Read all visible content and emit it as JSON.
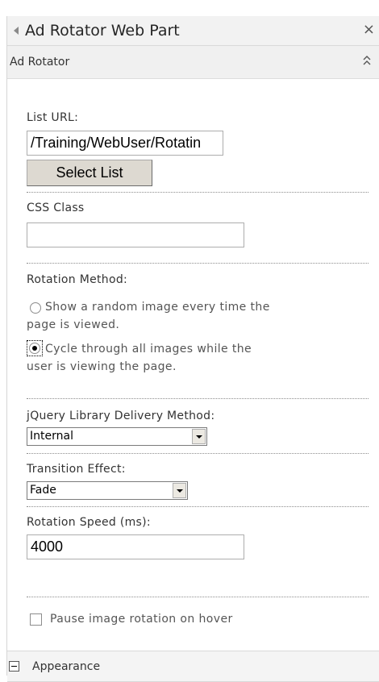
{
  "panel": {
    "title": "Ad Rotator Web Part",
    "close_glyph": "×"
  },
  "section": {
    "title": "Ad Rotator"
  },
  "fields": {
    "list_url": {
      "label": "List URL:",
      "value": "/Training/WebUser/Rotatin",
      "button": "Select List"
    },
    "css_class": {
      "label": "CSS Class",
      "value": ""
    },
    "rotation_method": {
      "label": "Rotation Method:",
      "options": [
        {
          "line1": "Show a random image every time the",
          "line2": "page is viewed.",
          "checked": false
        },
        {
          "line1": "Cycle through all images while the",
          "line2": "user is viewing the page.",
          "checked": true
        }
      ]
    },
    "jquery_method": {
      "label": "jQuery Library Delivery Method:",
      "selected": "Internal"
    },
    "transition_effect": {
      "label": "Transition Effect:",
      "selected": "Fade"
    },
    "rotation_speed": {
      "label": "Rotation Speed (ms):",
      "value": "4000"
    },
    "pause_on_hover": {
      "label": "Pause image rotation on hover",
      "checked": false
    }
  },
  "appearance": {
    "title": "Appearance"
  }
}
